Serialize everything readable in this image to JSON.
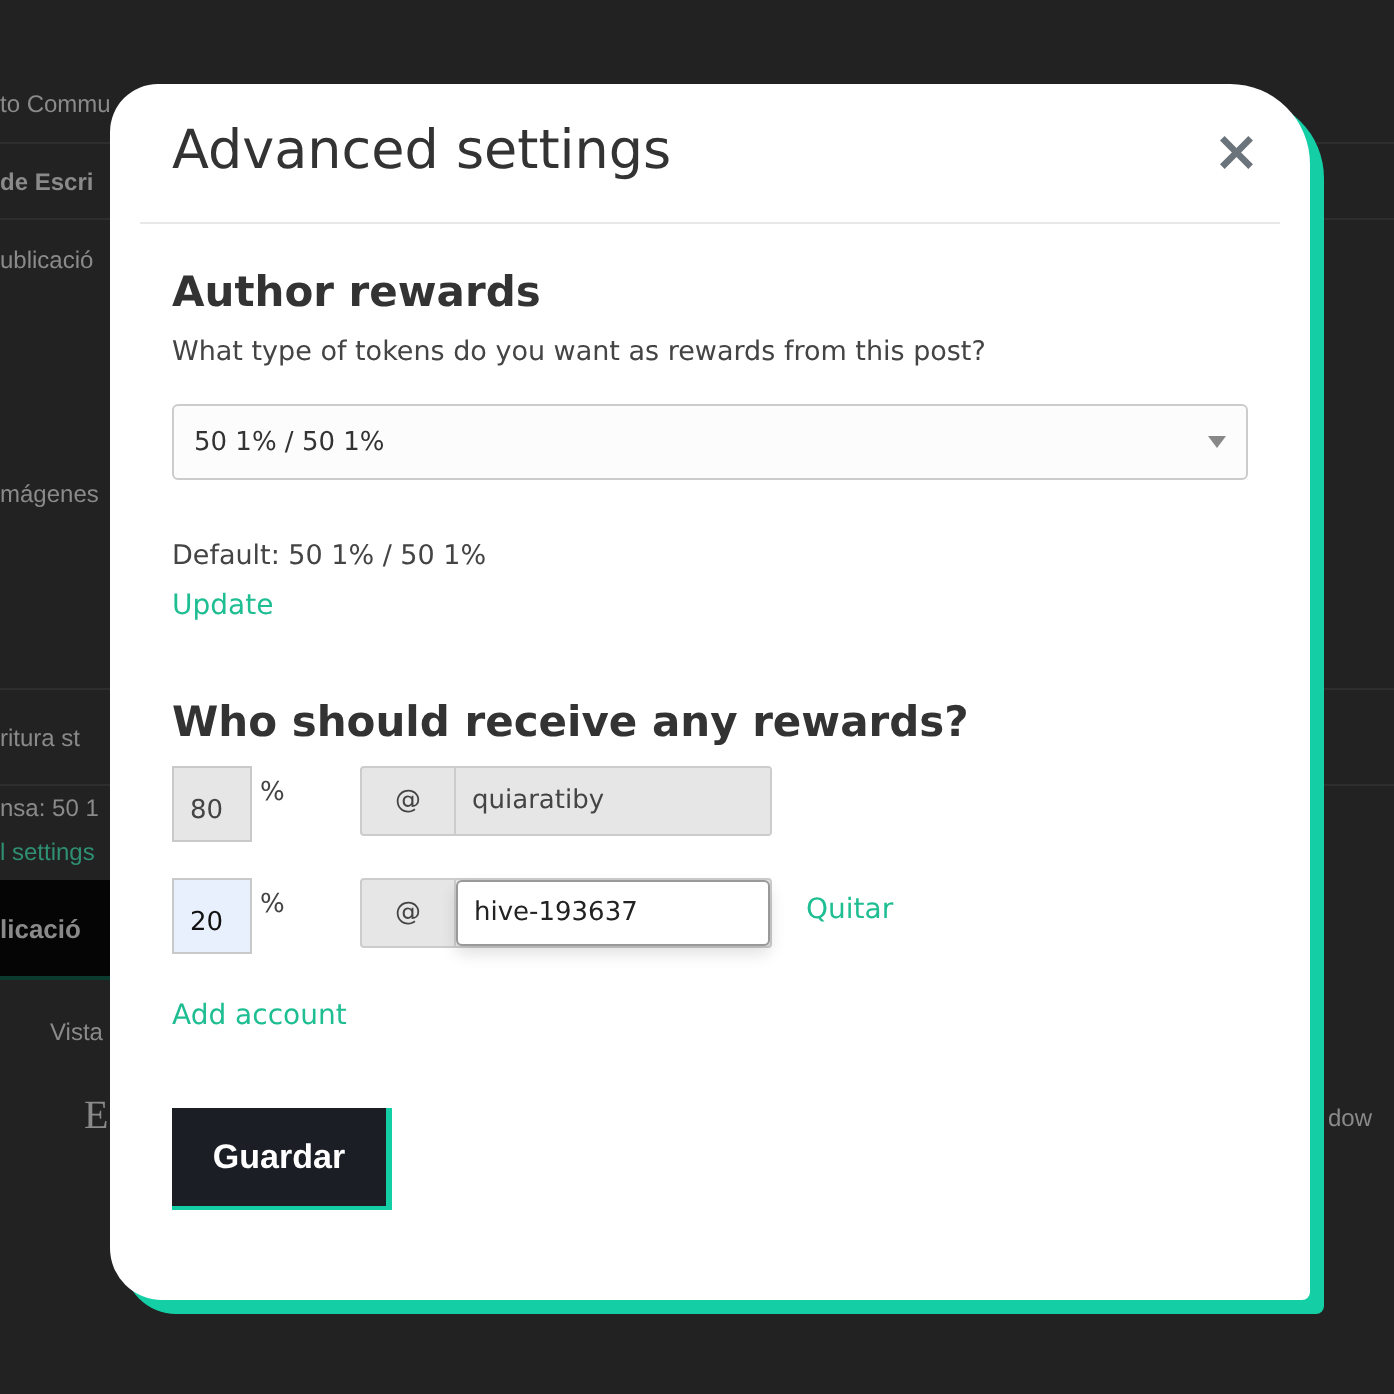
{
  "background": {
    "texts": [
      {
        "kind": "plain",
        "text": "to Commu"
      },
      {
        "kind": "bold",
        "text": "de Escri"
      },
      {
        "kind": "plain",
        "text": "ublicació"
      },
      {
        "kind": "plain",
        "text": "mágenes"
      },
      {
        "kind": "plain",
        "text": "ritura st"
      },
      {
        "kind": "plain",
        "text": "nsa: 50 1"
      },
      {
        "kind": "link",
        "text": "l settings"
      },
      {
        "kind": "button",
        "text": "licació"
      },
      {
        "kind": "plain",
        "text": "Vista"
      },
      {
        "kind": "serif",
        "text": "E"
      }
    ],
    "right_text": "dow"
  },
  "modal": {
    "title": "Advanced settings",
    "close": "×",
    "author_rewards": {
      "heading": "Author rewards",
      "question": "What type of tokens do you want as rewards from this post?",
      "select_value": "50 1% / 50 1%",
      "default": "Default: 50 1% / 50 1%",
      "update_link": "Update"
    },
    "beneficiaries": {
      "heading": "Who should receive any rewards?",
      "rows": [
        {
          "percent": "80",
          "percent_sign": "%",
          "at": "@",
          "account": "quiaratiby",
          "disabled": true
        },
        {
          "percent": "20",
          "percent_sign": "%",
          "at": "@",
          "account": "hive-193637",
          "disabled": false,
          "remove": "Quitar"
        }
      ],
      "add_link": "Add account"
    },
    "save_button": "Guardar"
  }
}
